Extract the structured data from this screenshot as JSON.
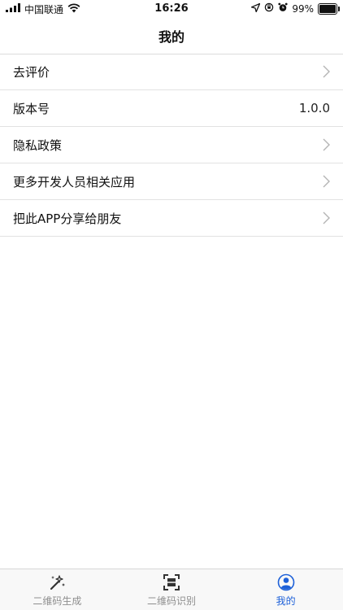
{
  "status_bar": {
    "carrier": "中国联通",
    "time": "16:26",
    "battery_percent_text": "99%",
    "battery_level": 0.99
  },
  "nav": {
    "title": "我的"
  },
  "list": {
    "items": [
      {
        "label": "去评价",
        "value": "",
        "has_chevron": true
      },
      {
        "label": "版本号",
        "value": "1.0.0",
        "has_chevron": false
      },
      {
        "label": "隐私政策",
        "value": "",
        "has_chevron": true
      },
      {
        "label": "更多开发人员相关应用",
        "value": "",
        "has_chevron": true
      },
      {
        "label": "把此APP分享给朋友",
        "value": "",
        "has_chevron": true
      }
    ]
  },
  "tab_bar": {
    "tabs": [
      {
        "label": "二维码生成",
        "icon": "magic-wand-icon",
        "active": false
      },
      {
        "label": "二维码识别",
        "icon": "scan-icon",
        "active": false
      },
      {
        "label": "我的",
        "icon": "user-icon",
        "active": true
      }
    ],
    "active_color": "#1d60d8",
    "inactive_color": "#8e8e8e"
  }
}
